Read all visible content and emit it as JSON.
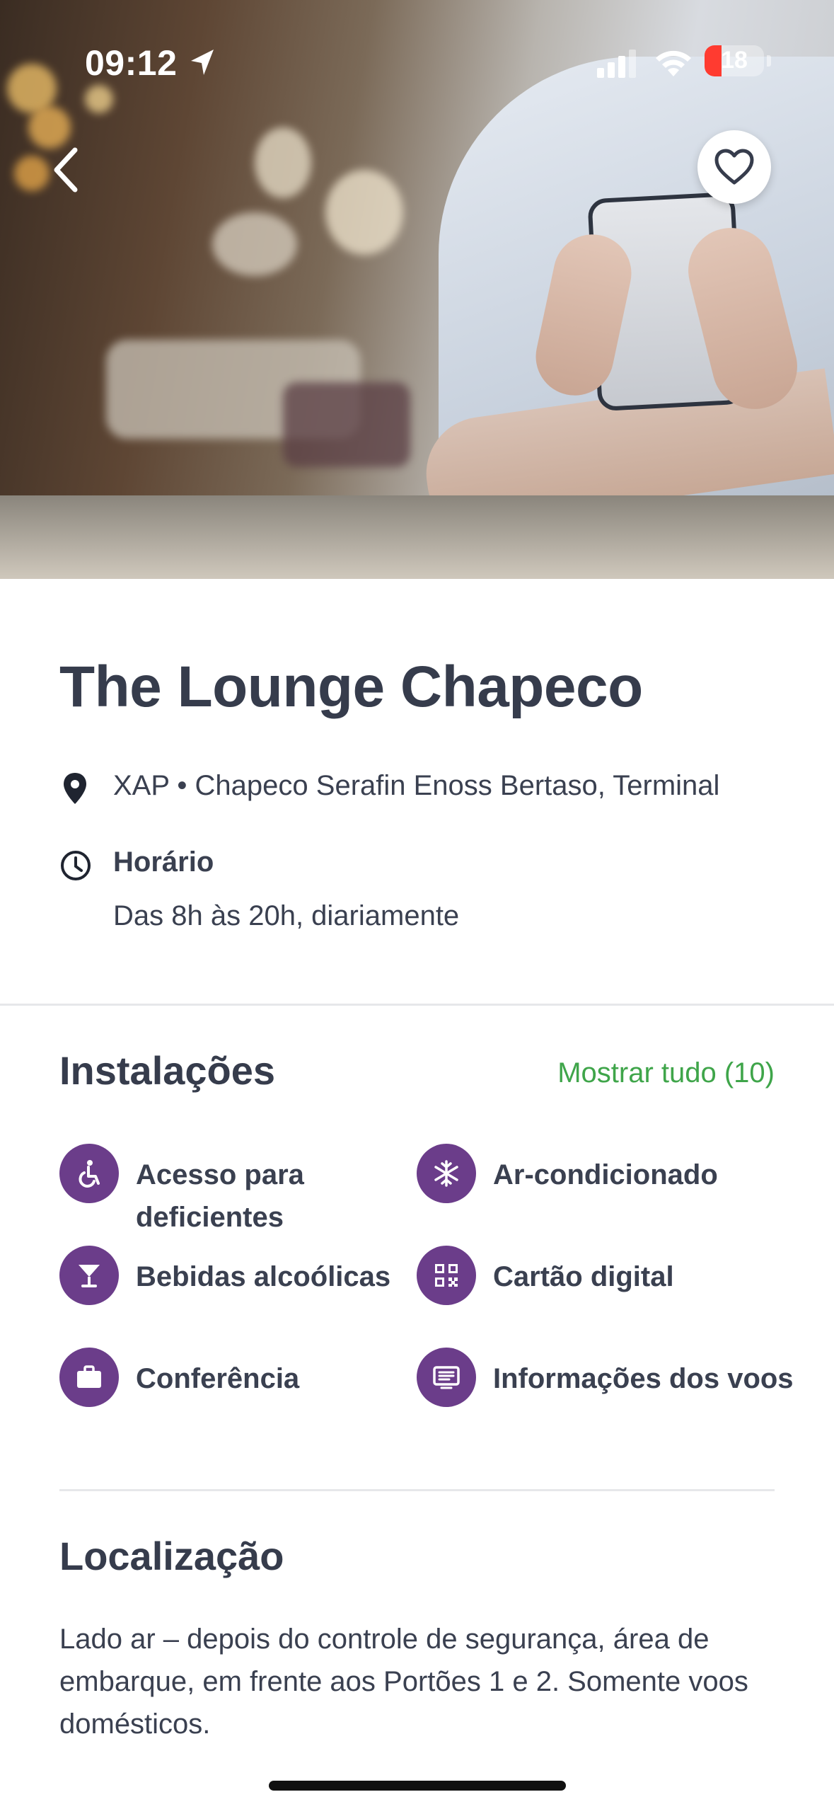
{
  "status_bar": {
    "time": "09:12",
    "battery": "18"
  },
  "lounge": {
    "name": "The Lounge Chapeco",
    "address": "XAP • Chapeco Serafin Enoss Bertaso, Terminal",
    "hours_label": "Horário",
    "hours_value": "Das 8h às 20h, diariamente"
  },
  "facilities": {
    "title": "Instalações",
    "show_all": "Mostrar tudo (10)",
    "items": [
      {
        "label": "Acesso para deficientes",
        "icon": "wheelchair-icon"
      },
      {
        "label": "Ar-condicionado",
        "icon": "snowflake-icon"
      },
      {
        "label": "Bebidas alcoólicas",
        "icon": "cocktail-icon"
      },
      {
        "label": "Cartão digital",
        "icon": "qr-code-icon"
      },
      {
        "label": "Conferência",
        "icon": "briefcase-icon"
      },
      {
        "label": "Informações dos voos",
        "icon": "monitor-icon"
      }
    ]
  },
  "location": {
    "title": "Localização",
    "description": "Lado ar – depois do controle de segurança, área de embarque, em frente aos Portões 1 e 2. Somente voos domésticos."
  },
  "colors": {
    "accent_purple": "#6b3d8a",
    "link_green": "#3fa54a",
    "text_dark": "#363c4c",
    "battery_red": "#ff3b30"
  }
}
